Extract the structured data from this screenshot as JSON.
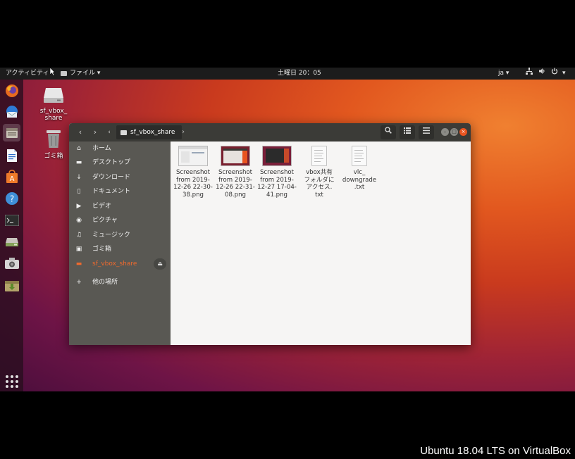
{
  "topbar": {
    "activities": "アクティビティ",
    "app_menu": "ファイル ▾",
    "clock": "土曜日 20：05",
    "lang": "ja ▾",
    "tray_icons": [
      "network-icon",
      "volume-icon",
      "power-icon"
    ]
  },
  "dock": {
    "items": [
      "firefox-icon",
      "thunderbird-icon",
      "files-icon",
      "writer-icon",
      "software-center-icon",
      "help-icon",
      "terminal-icon",
      "disk-icon",
      "screenshot-icon",
      "install-icon"
    ],
    "show_apps": "show-applications-icon"
  },
  "desktop": {
    "icons": [
      {
        "label": "sf_vbox_\nshare",
        "icon": "drive-icon"
      },
      {
        "label": "ゴミ箱",
        "icon": "trash-icon"
      }
    ]
  },
  "window": {
    "path": "sf_vbox_share",
    "sidebar": [
      {
        "label": "ホーム",
        "icon": "home-icon"
      },
      {
        "label": "デスクトップ",
        "icon": "desktop-folder-icon"
      },
      {
        "label": "ダウンロード",
        "icon": "download-icon"
      },
      {
        "label": "ドキュメント",
        "icon": "document-icon"
      },
      {
        "label": "ビデオ",
        "icon": "video-icon"
      },
      {
        "label": "ピクチャ",
        "icon": "picture-icon"
      },
      {
        "label": "ミュージック",
        "icon": "music-icon"
      },
      {
        "label": "ゴミ箱",
        "icon": "trash-icon"
      },
      {
        "label": "sf_vbox_share",
        "icon": "drive-icon",
        "active": true
      },
      {
        "label": "他の場所",
        "icon": "plus-icon"
      }
    ],
    "files": [
      {
        "name": "Screenshot from 2019-12-26 22-30-38.png",
        "lines": [
          "Screenshot",
          "from 2019-",
          "12-26 22-30-",
          "38.png"
        ],
        "type": "image"
      },
      {
        "name": "Screenshot from 2019-12-26 22-31-08.png",
        "lines": [
          "Screenshot",
          "from 2019-",
          "12-26 22-31-",
          "08.png"
        ],
        "type": "image"
      },
      {
        "name": "Screenshot from 2019-12-27 17-04-41.png",
        "lines": [
          "Screenshot",
          "from 2019-",
          "12-27 17-04-",
          "41.png"
        ],
        "type": "image"
      },
      {
        "name": "vbox共有フォルダにアクセス.txt",
        "lines": [
          "vbox共有",
          "フォルダに",
          "アクセス.",
          "txt"
        ],
        "type": "text"
      },
      {
        "name": "vlc_downgrade.txt",
        "lines": [
          "vlc_",
          "downgrade",
          ".txt"
        ],
        "type": "text"
      }
    ]
  },
  "caption": "Ubuntu 18.04 LTS on VirtualBox",
  "colors": {
    "accent": "#ef6a2e",
    "sidebar_bg": "#595853",
    "header_bg": "#3b3b37",
    "topbar_bg": "#1c1c1c"
  }
}
